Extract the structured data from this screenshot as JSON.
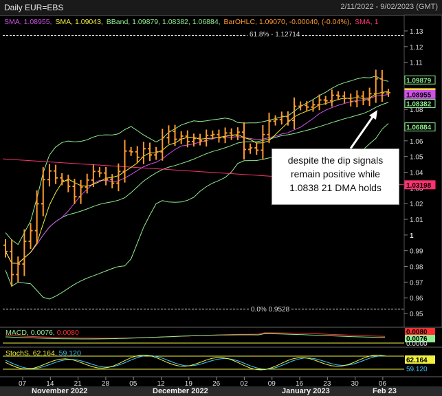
{
  "header": {
    "title": "Daily EUR=EBS",
    "range": "2/11/2022 - 9/02/2023 (GMT)"
  },
  "legend": [
    {
      "text": "SMA, 1.08955,",
      "color": "#d050e8"
    },
    {
      "text": "SMA, 1.09043,",
      "color": "#f0f040"
    },
    {
      "text": "BBand, 1.09879, 1.08382, 1.06884,",
      "color": "#90ee90"
    },
    {
      "text": "BarOHLC, 1.09070, -0.00040, (-0.04%),",
      "color": "#ff9a2e"
    },
    {
      "text": "SMA, 1",
      "color": "#ff3070"
    }
  ],
  "annotation": {
    "lines": [
      "despite the dip signals",
      "remain positive while",
      "1.0838 21 DMA holds"
    ]
  },
  "fib_top": "61.8% - 1.12714",
  "fib_bottom": "0.0%    0.9528",
  "price_axis_ticks": [
    "1.13",
    "1.12",
    "1.11",
    "1.1",
    "1.09",
    "1.08",
    "1.07",
    "1.06",
    "1.05",
    "1.04",
    "1.03",
    "1.02",
    "1.01",
    "1",
    "0.99",
    "0.98",
    "0.97",
    "0.96",
    "0.95"
  ],
  "price_axis_major": "1",
  "price_labels": [
    {
      "text": "1.09879",
      "bg": "#000000",
      "fg": "#90ee90",
      "border": "#90ee90",
      "price": 1.09879
    },
    {
      "text": "1.09070",
      "bg": "#ff9a2e",
      "fg": "#000000",
      "border": "#ff9a2e",
      "price": 1.0907
    },
    {
      "text": "1.09043",
      "bg": "#f0f040",
      "fg": "#000000",
      "border": "#f0f040",
      "price": 1.09043
    },
    {
      "text": "1.08955",
      "bg": "#d050e8",
      "fg": "#000000",
      "border": "#d050e8",
      "price": 1.08955
    },
    {
      "text": "1.08382",
      "bg": "#000000",
      "fg": "#90ee90",
      "border": "#90ee90",
      "price": 1.08382
    },
    {
      "text": "1.06884",
      "bg": "#000000",
      "fg": "#90ee90",
      "border": "#90ee90",
      "price": 1.06884
    },
    {
      "text": "1.03198",
      "bg": "#ff3070",
      "fg": "#000000",
      "border": "#ff3070",
      "price": 1.03198
    }
  ],
  "macd": {
    "label": "MACD,",
    "v1": "0.0076,",
    "v2": "0.0080",
    "axis": [
      "0.0080",
      "0.0076",
      "0.0000"
    ]
  },
  "stoch": {
    "label": "StochS,",
    "v1": "62.164,",
    "v2": "59.120",
    "axis": [
      "62.164",
      "59.120"
    ]
  },
  "x_ticks": [
    "07",
    "14",
    "21",
    "28",
    "05",
    "12",
    "19",
    "26",
    "02",
    "09",
    "16",
    "23",
    "30",
    "06"
  ],
  "months": [
    "November 2022",
    "December 2022",
    "January 2023",
    "Feb 23"
  ],
  "chart_data": {
    "type": "ohlc",
    "title": "Daily EUR=EBS",
    "date_range": "2/11/2022 - 9/02/2023 (GMT)",
    "ylim": [
      0.945,
      1.138
    ],
    "price_series": {
      "name": "BarOHLC",
      "color": "#ff9a2e",
      "close": [
        0.9895,
        0.9748,
        0.9815,
        0.996,
        1.0028,
        1.0199,
        1.0353,
        1.0408,
        1.0364,
        1.0347,
        1.031,
        1.0244,
        1.0305,
        1.035,
        1.0405,
        1.0395,
        1.0355,
        1.033,
        1.0405,
        1.0535,
        1.053,
        1.0495,
        1.055,
        1.051,
        1.053,
        1.062,
        1.066,
        1.061,
        1.063,
        1.0595,
        1.0615,
        1.06,
        1.0635,
        1.064,
        1.062,
        1.065,
        1.0635,
        1.0655,
        1.0545,
        1.0555,
        1.054,
        1.064,
        1.0725,
        1.0735,
        1.0755,
        1.073,
        1.082,
        1.0825,
        1.0815,
        1.083,
        1.086,
        1.0855,
        1.089,
        1.0885,
        1.087,
        1.085,
        1.0885,
        1.086,
        1.09,
        1.0995,
        1.0905,
        1.0907
      ]
    },
    "sma_long": {
      "name": "SMA",
      "color": "#ff3070",
      "start": 1.0485,
      "end": 1.03198
    },
    "sma_mid": {
      "name": "SMA",
      "color": "#d050e8",
      "last": 1.08955
    },
    "sma_short": {
      "name": "SMA",
      "color": "#f0f040",
      "last": 1.09043
    },
    "bollinger": {
      "name": "BBand",
      "color": "#90ee90",
      "upper": 1.09879,
      "middle": 1.08382,
      "lower": 1.06884
    },
    "fib_levels": [
      {
        "label": "61.8%",
        "value": 1.12714
      },
      {
        "label": "0.0%",
        "value": 0.9528
      }
    ],
    "macd": {
      "name": "MACD",
      "values": [
        0.0076,
        0.008
      ]
    },
    "stochastic": {
      "name": "StochS",
      "values": [
        62.164,
        59.12
      ]
    }
  }
}
